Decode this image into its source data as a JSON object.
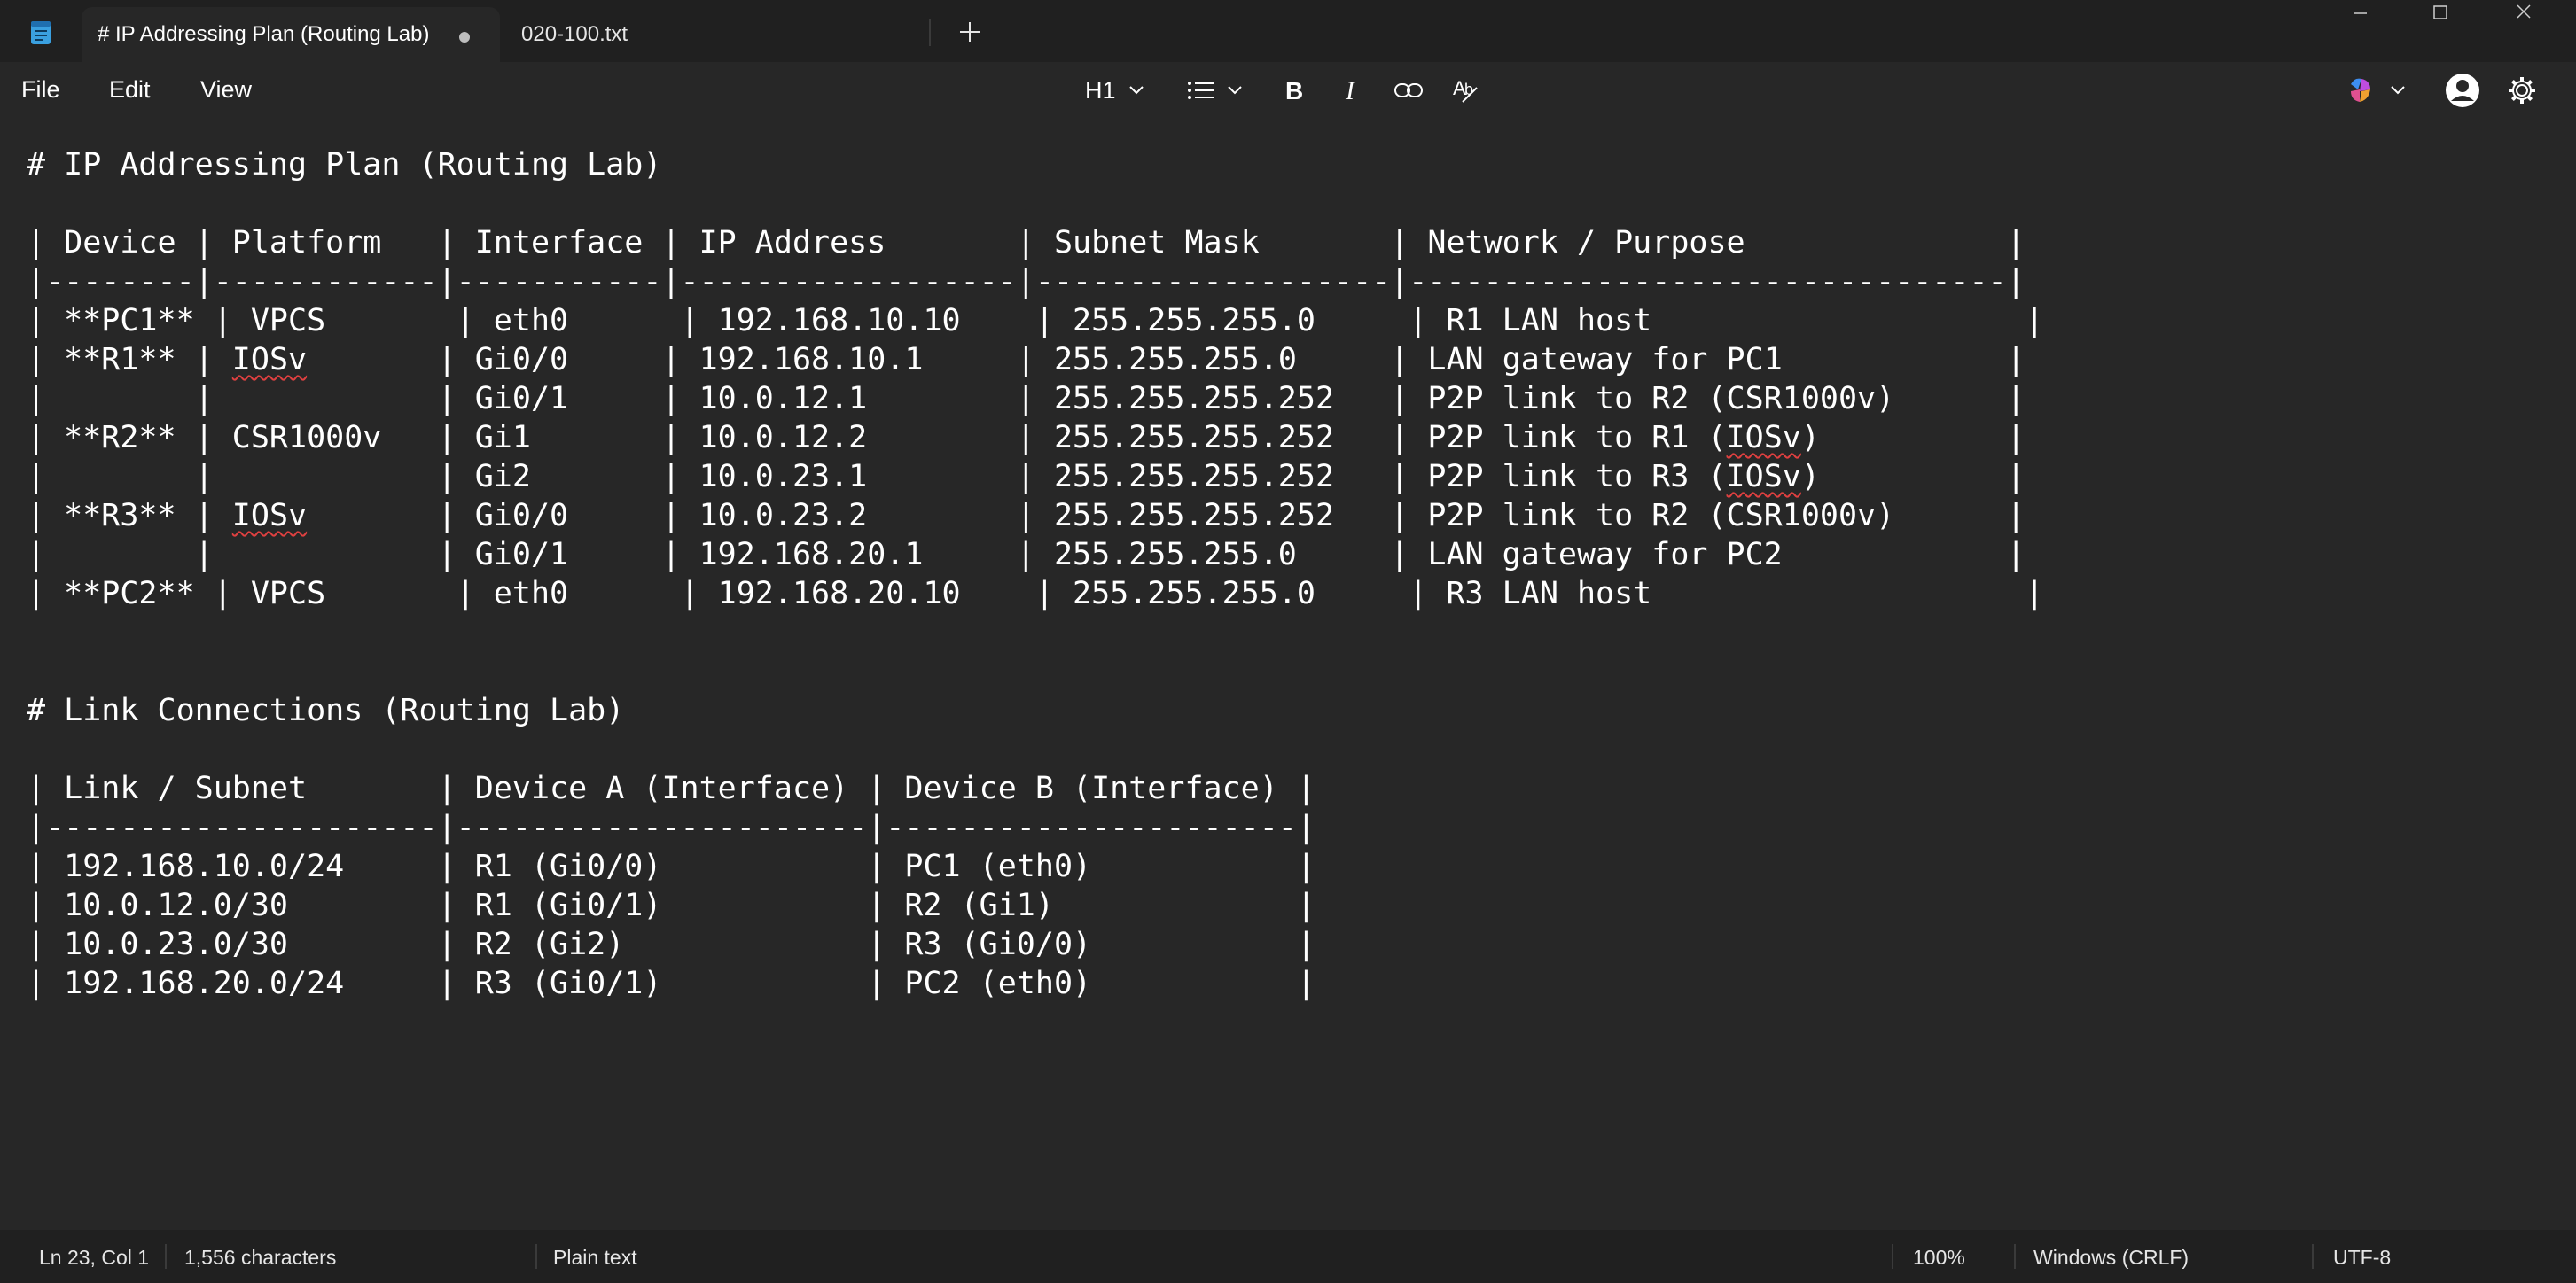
{
  "tabs": [
    {
      "label": "# IP Addressing Plan (Routing Lab)",
      "unsaved": true,
      "active": true
    },
    {
      "label": "020-100.txt",
      "active": false
    }
  ],
  "menu": {
    "file": "File",
    "edit": "Edit",
    "view": "View"
  },
  "toolbar": {
    "heading": "H1",
    "icons": [
      "heading-dropdown",
      "list-icon",
      "bold-icon",
      "italic-icon",
      "link-icon",
      "clear-formatting-icon",
      "copilot-icon",
      "account-icon",
      "settings-icon"
    ]
  },
  "editor": {
    "lines": [
      "# IP Addressing Plan (Routing Lab)",
      "",
      "| Device | Platform   | Interface | IP Address       | Subnet Mask       | Network / Purpose              |",
      "|--------|------------|-----------|------------------|-------------------|--------------------------------|",
      "| **PC1** | VPCS       | eth0      | 192.168.10.10    | 255.255.255.0     | R1 LAN host                    |",
      "| **R1** | IOSv       | Gi0/0     | 192.168.10.1     | 255.255.255.0     | LAN gateway for PC1            |",
      "|        |            | Gi0/1     | 10.0.12.1        | 255.255.255.252   | P2P link to R2 (CSR1000v)      |",
      "| **R2** | CSR1000v   | Gi1       | 10.0.12.2        | 255.255.255.252   | P2P link to R1 (IOSv)          |",
      "|        |            | Gi2       | 10.0.23.1        | 255.255.255.252   | P2P link to R3 (IOSv)          |",
      "| **R3** | IOSv       | Gi0/0     | 10.0.23.2        | 255.255.255.252   | P2P link to R2 (CSR1000v)      |",
      "|        |            | Gi0/1     | 192.168.20.1     | 255.255.255.0     | LAN gateway for PC2            |",
      "| **PC2** | VPCS       | eth0      | 192.168.20.10    | 255.255.255.0     | R3 LAN host                    |",
      "",
      "",
      "# Link Connections (Routing Lab)",
      "",
      "| Link / Subnet       | Device A (Interface) | Device B (Interface) |",
      "|---------------------|----------------------|----------------------|",
      "| 192.168.10.0/24     | R1 (Gi0/0)           | PC1 (eth0)           |",
      "| 10.0.12.0/30        | R1 (Gi0/1)           | R2 (Gi1)             |",
      "| 10.0.23.0/30        | R2 (Gi2)             | R3 (Gi0/0)           |",
      "| 192.168.20.0/24     | R3 (Gi0/1)           | PC2 (eth0)           |"
    ],
    "spellcheck_word": "IOSv"
  },
  "status": {
    "position": "Ln 23, Col 1",
    "characters": "1,556 characters",
    "format": "Plain text",
    "zoom": "100%",
    "line_ending": "Windows (CRLF)",
    "encoding": "UTF-8"
  }
}
